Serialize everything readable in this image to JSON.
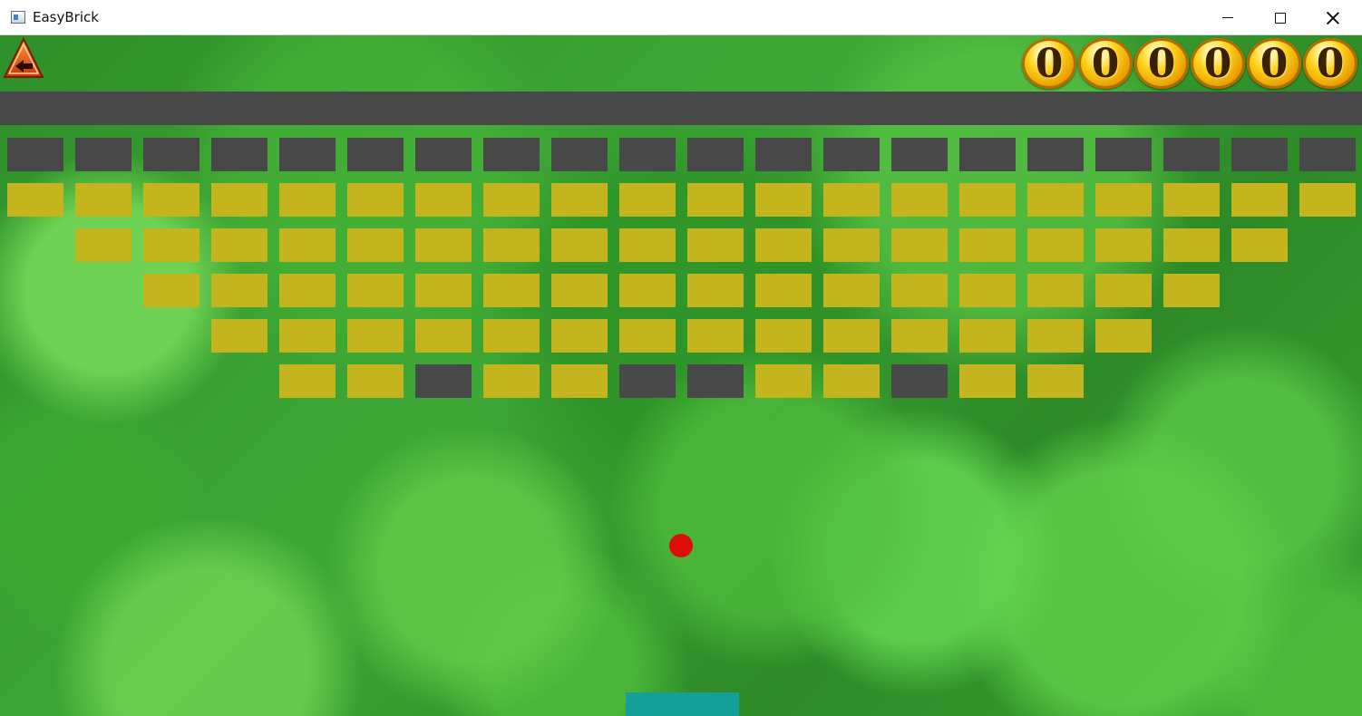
{
  "window": {
    "title": "EasyBrick",
    "minimize_glyph": "minimize-icon",
    "maximize_glyph": "maximize-icon",
    "close_glyph": "close-icon"
  },
  "hud": {
    "back_icon": "back-arrow-icon",
    "score_digits": [
      "0",
      "0",
      "0",
      "0",
      "0",
      "0"
    ]
  },
  "colors": {
    "brick_yellow": "#c4b51e",
    "brick_gray": "#484848",
    "ball": "#e00d0d",
    "paddle": "#14a096"
  },
  "bricks": {
    "rows": [
      [
        "G",
        "G",
        "G",
        "G",
        "G",
        "G",
        "G",
        "G",
        "G",
        "G",
        "G",
        "G",
        "G",
        "G",
        "G",
        "G",
        "G",
        "G",
        "G",
        "G"
      ],
      [
        "Y",
        "Y",
        "Y",
        "Y",
        "Y",
        "Y",
        "Y",
        "Y",
        "Y",
        "Y",
        "Y",
        "Y",
        "Y",
        "Y",
        "Y",
        "Y",
        "Y",
        "Y",
        "Y",
        "Y"
      ],
      [
        ".",
        "Y",
        "Y",
        "Y",
        "Y",
        "Y",
        "Y",
        "Y",
        "Y",
        "Y",
        "Y",
        "Y",
        "Y",
        "Y",
        "Y",
        "Y",
        "Y",
        "Y",
        "Y",
        "."
      ],
      [
        ".",
        ".",
        "Y",
        "Y",
        "Y",
        "Y",
        "Y",
        "Y",
        "Y",
        "Y",
        "Y",
        "Y",
        "Y",
        "Y",
        "Y",
        "Y",
        "Y",
        "Y",
        ".",
        "."
      ],
      [
        ".",
        ".",
        ".",
        "Y",
        "Y",
        "Y",
        "Y",
        "Y",
        "Y",
        "Y",
        "Y",
        "Y",
        "Y",
        "Y",
        "Y",
        "Y",
        "Y",
        ".",
        ".",
        "."
      ],
      [
        ".",
        ".",
        ".",
        ".",
        "Y",
        "Y",
        "G",
        "Y",
        "Y",
        "G",
        "G",
        "Y",
        "Y",
        "G",
        "Y",
        "Y",
        ".",
        ".",
        ".",
        "."
      ]
    ]
  }
}
